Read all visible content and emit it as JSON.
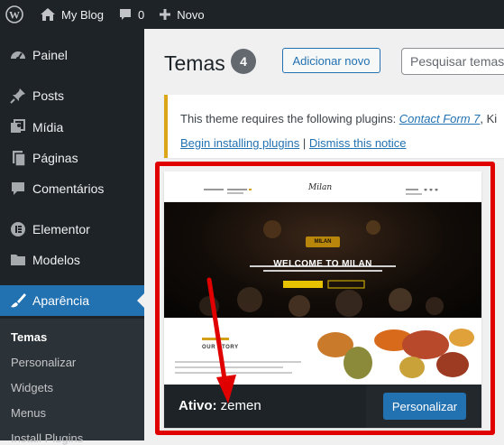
{
  "admin_bar": {
    "site_name": "My Blog",
    "comments_count": "0",
    "new_label": "Novo"
  },
  "sidebar": {
    "items": [
      {
        "label": "Painel",
        "icon": "dashboard-icon"
      },
      {
        "label": "Posts",
        "icon": "pin-icon"
      },
      {
        "label": "Mídia",
        "icon": "media-icon"
      },
      {
        "label": "Páginas",
        "icon": "pages-icon"
      },
      {
        "label": "Comentários",
        "icon": "comments-icon"
      },
      {
        "label": "Elementor",
        "icon": "elementor-icon"
      },
      {
        "label": "Modelos",
        "icon": "folder-icon"
      },
      {
        "label": "Aparência",
        "icon": "brush-icon"
      }
    ],
    "submenu": [
      "Temas",
      "Personalizar",
      "Widgets",
      "Menus",
      "Install Plugins"
    ]
  },
  "header": {
    "title": "Temas",
    "count": "4",
    "add_new": "Adicionar novo",
    "search_placeholder": "Pesquisar temas i"
  },
  "notice": {
    "text_prefix": "This theme requires the following plugins: ",
    "plugin_link": "Contact Form 7",
    "text_suffix": ", Ki",
    "begin_link": "Begin installing plugins",
    "separator": " | ",
    "dismiss_link": "Dismiss this notice"
  },
  "theme": {
    "preview": {
      "logo": "Milan",
      "emblem": "MILAN",
      "hero_title": "WELCOME TO MILAN",
      "story_title": "OUR STORY"
    },
    "active_prefix": "Ativo:",
    "active_name": "zemen",
    "customize": "Personalizar"
  },
  "colors": {
    "admin_dark": "#1d2327",
    "accent": "#2271b1",
    "highlight": "#e00000",
    "notice_border": "#dba617"
  }
}
